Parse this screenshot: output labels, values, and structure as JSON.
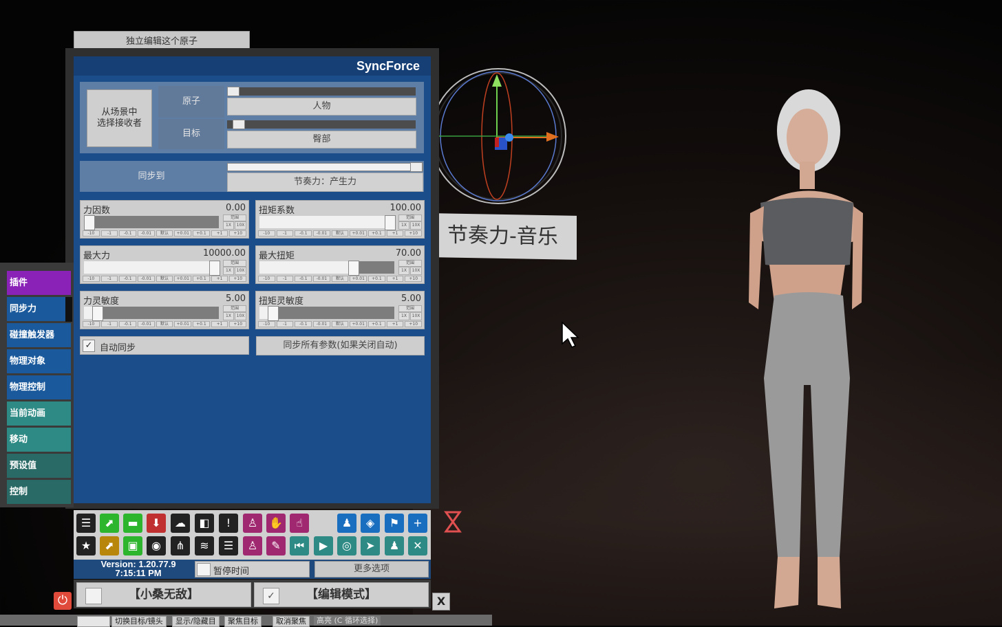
{
  "top_button": "独立编辑这个原子",
  "plugin_name": "SyncForce",
  "receiver": {
    "pick_button_line1": "从场景中",
    "pick_button_line2": "选择接收者",
    "atom_label": "原子",
    "atom_value": "人物",
    "target_label": "目标",
    "target_value": "臀部"
  },
  "sync": {
    "label": "同步到",
    "value": "节奏力：产生力"
  },
  "params": [
    {
      "name": "力因数",
      "value": "0.00",
      "level": 0.0
    },
    {
      "name": "扭矩系数",
      "value": "100.00",
      "level": 1.0
    },
    {
      "name": "最大力",
      "value": "10000.00",
      "level": 1.0
    },
    {
      "name": "最大扭矩",
      "value": "70.00",
      "level": 0.7
    },
    {
      "name": "力灵敏度",
      "value": "5.00",
      "level": 0.1
    },
    {
      "name": "扭矩灵敏度",
      "value": "5.00",
      "level": 0.1
    }
  ],
  "step_buttons": [
    "-10",
    "-1",
    "-0.1",
    "-0.01",
    "默认",
    "+0.01",
    "+0.1",
    "+1",
    "+10"
  ],
  "range_labels": {
    "range": "范围",
    "x1": "1X",
    "x10": "10X"
  },
  "auto_sync": {
    "label": "自动同步",
    "checked": true,
    "check_glyph": "✓"
  },
  "sync_all_button": "同步所有参数(如果关闭自动)",
  "sidebar": {
    "items": [
      {
        "label": "插件",
        "color": "#8a22b8"
      },
      {
        "label": "同步力",
        "color": "#1a5a9c"
      },
      {
        "label": "碰撞触发器",
        "color": "#1a5a9c"
      },
      {
        "label": "物理对象",
        "color": "#1a5a9c"
      },
      {
        "label": "物理控制",
        "color": "#1a5a9c"
      },
      {
        "label": "当前动画",
        "color": "#2e8a84"
      },
      {
        "label": "移动",
        "color": "#2e8a84"
      },
      {
        "label": "预设值",
        "color": "#2a6a66"
      },
      {
        "label": "控制",
        "color": "#2a6a66"
      }
    ]
  },
  "toolbar": {
    "row1": [
      {
        "icon": "menu-icon",
        "glyph": "☰",
        "color": "#222"
      },
      {
        "icon": "open-scene-icon",
        "glyph": "⬈",
        "color": "#2db52d"
      },
      {
        "icon": "folder-icon",
        "glyph": "▬",
        "color": "#2db52d"
      },
      {
        "icon": "save-icon",
        "glyph": "⬇",
        "color": "#c03030"
      },
      {
        "icon": "cloud-icon",
        "glyph": "☁",
        "color": "#222"
      },
      {
        "icon": "box-icon",
        "glyph": "◧",
        "color": "#222"
      },
      {
        "icon": "alert-icon",
        "glyph": "!",
        "color": "#222"
      },
      {
        "icon": "add-person-icon",
        "glyph": "♙",
        "color": "#a02870"
      },
      {
        "icon": "hand-icon",
        "glyph": "✋",
        "color": "#a02870"
      },
      {
        "icon": "pointer-hand-icon",
        "glyph": "☝",
        "color": "#a02870"
      },
      {
        "icon": "person-icon",
        "glyph": "♟",
        "color": "#1a6ec0"
      },
      {
        "icon": "unity-icon",
        "glyph": "◈",
        "color": "#1a6ec0"
      },
      {
        "icon": "flag-icon",
        "glyph": "⚑",
        "color": "#1a6ec0"
      },
      {
        "icon": "plus-icon",
        "glyph": "+",
        "color": "#1a6ec0"
      }
    ],
    "row2": [
      {
        "icon": "star-icon",
        "glyph": "★",
        "color": "#222"
      },
      {
        "icon": "load-icon",
        "glyph": "⬈",
        "color": "#b8860b"
      },
      {
        "icon": "add-folder-icon",
        "glyph": "▣",
        "color": "#2db52d"
      },
      {
        "icon": "camera-icon",
        "glyph": "◉",
        "color": "#222"
      },
      {
        "icon": "graph-icon",
        "glyph": "⋔",
        "color": "#222"
      },
      {
        "icon": "layers-icon",
        "glyph": "≋",
        "color": "#222"
      },
      {
        "icon": "document-icon",
        "glyph": "☰",
        "color": "#222"
      },
      {
        "icon": "remove-person-icon",
        "glyph": "♙",
        "color": "#a02870"
      },
      {
        "icon": "wrench-icon",
        "glyph": "✎",
        "color": "#a02870"
      },
      {
        "icon": "skip-back-icon",
        "glyph": "⏮",
        "color": "#2e8a84"
      },
      {
        "icon": "play-icon",
        "glyph": "▶",
        "color": "#2e8a84"
      },
      {
        "icon": "target-icon",
        "glyph": "◎",
        "color": "#2e8a84"
      },
      {
        "icon": "cursor-icon",
        "glyph": "➤",
        "color": "#2e8a84"
      },
      {
        "icon": "people-icon",
        "glyph": "♟",
        "color": "#2e8a84"
      },
      {
        "icon": "tools-icon",
        "glyph": "✕",
        "color": "#2e8a84"
      }
    ]
  },
  "version_line1": "Version: 1.20.77.9",
  "version_line2": "7:15:11 PM",
  "pause_time": "暂停时间",
  "more_options": "更多选项",
  "mode_left": "【小桑无敌】",
  "mode_right": "【编辑模式】",
  "mode_right_check": "✓",
  "close_glyph": "X",
  "power_glyph": "⏻",
  "bottom_bar": [
    "切换目标/镜头",
    "显示/隐藏目",
    "聚焦目标",
    "取消聚焦",
    "高亮 (C 循环选择)"
  ],
  "scene_label": "节奏力-音乐"
}
